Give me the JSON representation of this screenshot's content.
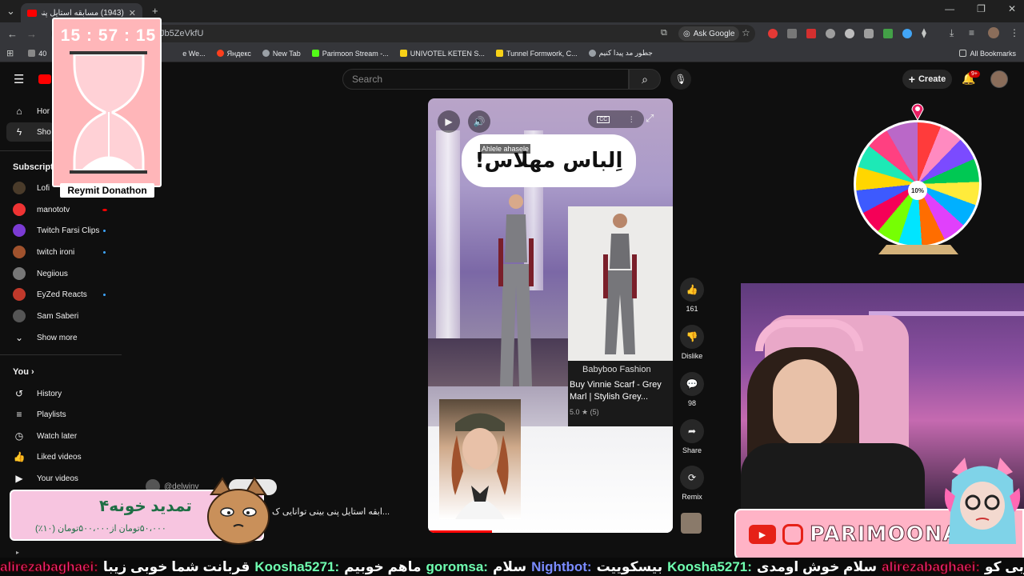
{
  "browser": {
    "tab_title": "(1943) مسابقه استایل پنی بینی",
    "url": "Jb5ZeVkfU",
    "ask_google": "Ask Google",
    "bookmarks": [
      {
        "label": "40",
        "color": "#888"
      },
      {
        "label": "e We...",
        "color": "#ff9800"
      },
      {
        "label": "Яндекс",
        "color": "#fc3f1d"
      },
      {
        "label": "New Tab",
        "color": "#9aa0a6"
      },
      {
        "label": "Parimoon Stream -...",
        "color": "#53fc18"
      },
      {
        "label": "UNIVOTEL KETEN S...",
        "color": "#f7d117"
      },
      {
        "label": "Tunnel Formwork, C...",
        "color": "#f7d117"
      },
      {
        "label": "جطور مد پیدا کنیم",
        "color": "#9aa0a6"
      }
    ],
    "all_bookmarks": "All Bookmarks"
  },
  "youtube": {
    "search_placeholder": "Search",
    "create_label": "Create",
    "notif_badge": "9+"
  },
  "sidebar": {
    "home": "Hor",
    "shorts": "Sho",
    "subscriptions_title": "Subscripti",
    "subs": [
      {
        "label": "Lofi",
        "color": "#4a3b2a",
        "dot": false
      },
      {
        "label": "manototv",
        "color": "#e33",
        "dot": true,
        "dot_color": "#f00"
      },
      {
        "label": "Twitch Farsi Clips",
        "color": "#7b3bd3",
        "dot": true,
        "dot_color": "#3ea6ff"
      },
      {
        "label": "twitch ironi",
        "color": "#a0522d",
        "dot": true,
        "dot_color": "#3ea6ff"
      },
      {
        "label": "Negiious",
        "color": "#777",
        "dot": false
      },
      {
        "label": "EyZed Reacts",
        "color": "#c0392b",
        "dot": true,
        "dot_color": "#3ea6ff"
      },
      {
        "label": "Sam Saberi",
        "color": "#555",
        "dot": false
      }
    ],
    "show_more": "Show more",
    "you_title": "You",
    "you_items": [
      "History",
      "Playlists",
      "Watch later",
      "Liked videos",
      "Your videos"
    ]
  },
  "timer": {
    "time": "15 : 57 : 15",
    "label": "Reymit Donathon"
  },
  "short": {
    "caption": "اِلباس مهلاس!",
    "tag": "Ahlele ahasele",
    "product_brand": "Babyboo Fashion",
    "product_title": "Buy Vinnie Scarf - Grey Marl | Stylish Grey...",
    "product_rating": "5.0 ★ (5)"
  },
  "actions": {
    "likes": "161",
    "dislike": "Dislike",
    "comments": "98",
    "share": "Share",
    "remix": "Remix"
  },
  "wheel": {
    "center": "10%"
  },
  "overlay": {
    "social_handle": "PARIMOONAM",
    "donate_title": "تمدید خونه۴",
    "donate_sub": "۵۰،۰۰۰تومان از۵۰۰،۰۰۰تومان (۱۰٪)",
    "comment_user": "@delwinv",
    "comment_text": "...ابقه استایل پنی بینی توانایی ک"
  },
  "ticker": [
    {
      "text": "alirezabaghaei:",
      "style": "red"
    },
    {
      "text": "قربانت شما خوبی زیبا",
      "style": "msg"
    },
    {
      "text": "Koosha5271:",
      "style": "green"
    },
    {
      "text": "ماهم خوبیم",
      "style": "msg"
    },
    {
      "text": "goromsa:",
      "style": "green"
    },
    {
      "text": "سلام",
      "style": "msg"
    },
    {
      "text": "Nightbot:",
      "style": "blue"
    },
    {
      "text": "بیسکوییت",
      "style": "msg"
    },
    {
      "text": "Koosha5271:",
      "style": "green"
    },
    {
      "text": "سلام خوش اومدی",
      "style": "msg"
    },
    {
      "text": "alirezabaghaei:",
      "style": "red"
    },
    {
      "text": "سوبی کو",
      "style": "msg"
    }
  ]
}
